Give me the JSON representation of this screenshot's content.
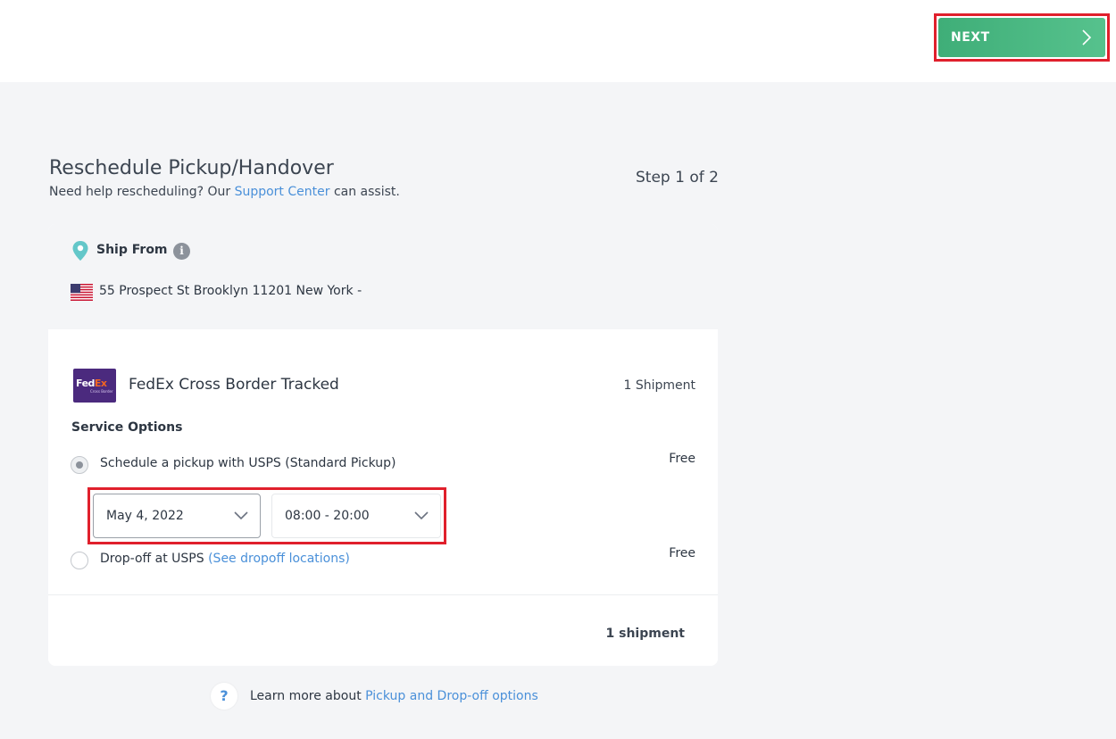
{
  "header": {
    "next_label": "NEXT"
  },
  "page": {
    "title": "Reschedule Pickup/Handover",
    "help_prefix": "Need help rescheduling? Our ",
    "help_link": "Support Center",
    "help_suffix": " can assist.",
    "step": "Step 1 of 2"
  },
  "ship_from": {
    "label": "Ship From",
    "address": "55 Prospect St Brooklyn 11201 New York -"
  },
  "carrier": {
    "name": "FedEx Cross Border Tracked",
    "shipment_count": "1 Shipment",
    "logo_text_a": "Fed",
    "logo_text_b": "Ex",
    "logo_sub": "Cross Border"
  },
  "service": {
    "heading": "Service Options",
    "options": [
      {
        "label": "Schedule a pickup with USPS (Standard Pickup)",
        "price": "Free",
        "selected": true
      },
      {
        "label": "Drop-off at USPS ",
        "link": "(See dropoff locations)",
        "price": "Free",
        "selected": false
      }
    ],
    "date_value": "May 4, 2022",
    "time_value": "08:00 - 20:00"
  },
  "footer": {
    "count": "1 shipment"
  },
  "learn": {
    "prefix": "Learn more about ",
    "link": "Pickup and Drop-off options",
    "icon_glyph": "?"
  },
  "colors": {
    "accent_green": "#4cb886",
    "link": "#4a90d9",
    "highlight": "#e0202c",
    "fedex_purple": "#4b2a7e",
    "fedex_orange": "#f26522"
  },
  "icons": [
    "chevron-right-icon",
    "location-pin-icon",
    "info-icon",
    "us-flag-icon",
    "chevron-down-icon",
    "question-icon"
  ]
}
